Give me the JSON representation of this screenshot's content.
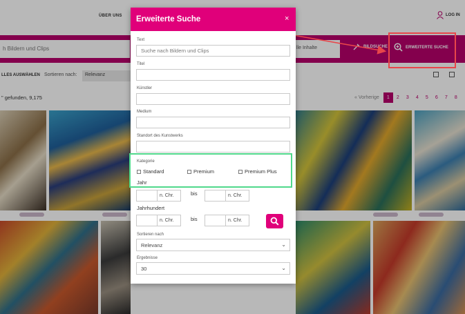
{
  "header": {
    "about_label": "ÜBER UNS",
    "login_label": "LOG IN"
  },
  "search_bar": {
    "placeholder": "h Bildern und Clips",
    "scope_label": "lle Inhalte",
    "bildsuche_label": "BILDSUCHE",
    "advanced_label": "ERWEITERTE SUCHE"
  },
  "results_toolbar": {
    "select_all_label": "LLES AUSWÄHLEN",
    "sort_label": "Sortieren nach:",
    "sort_value": "Relevanz",
    "found_text": "\" gefunden, 9,175"
  },
  "pagination": {
    "prev_label": "« Vorherige",
    "pages": [
      "1",
      "2",
      "3",
      "4",
      "5",
      "6",
      "7",
      "8"
    ],
    "active_page": "1"
  },
  "modal": {
    "title": "Erweiterte Suche",
    "close_label": "×",
    "text_label": "Text",
    "text_placeholder": "Suche nach Bildern und Clips",
    "title_label": "Titel",
    "artist_label": "Künstler",
    "medium_label": "Medium",
    "location_label": "Standort des Kunstwerks",
    "category_label": "Kategorie",
    "categories": [
      "Standard",
      "Premium",
      "Premium Plus"
    ],
    "year_label": "Jahr",
    "century_label": "Jahrhundert",
    "bis_label": "bis",
    "unit_label": "n. Chr.",
    "sort_label": "Sortieren nach",
    "sort_value": "Relevanz",
    "results_label": "Ergebnisse",
    "results_value": "30"
  },
  "colors": {
    "brand_magenta": "#e0007a",
    "search_bar": "#b8006b",
    "annotation_red": "#e8464a",
    "annotation_green": "#4fd88a"
  }
}
